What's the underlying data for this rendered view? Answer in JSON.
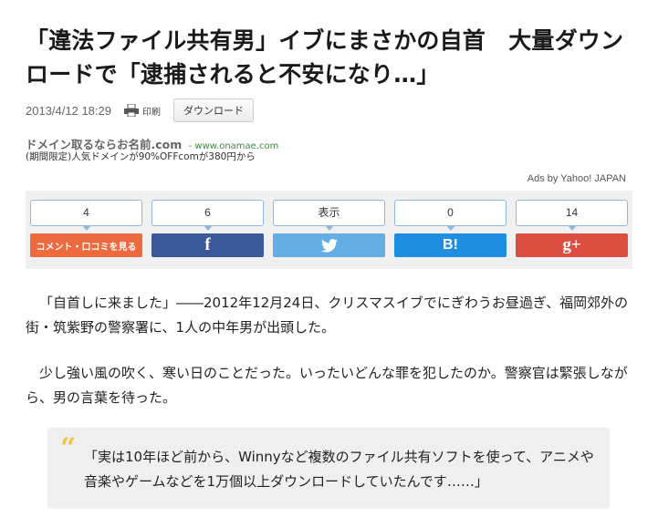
{
  "article": {
    "headline": "「違法ファイル共有男」イブにまさかの自首　大量ダウンロードで「逮捕されると不安になり…」",
    "date": "2013/4/12 18:29",
    "print_label": "印刷",
    "download_button": "ダウンロード"
  },
  "ad": {
    "title": "ドメイン取るならお名前.com",
    "url": "- www.onamae.com",
    "description": "(期間限定)人気ドメインが90%OFFcomが380円から",
    "credit": "Ads by Yahoo! JAPAN"
  },
  "share": {
    "comment": {
      "count": "4",
      "label": "コメント・口コミを見る",
      "color": "#ec6a3e"
    },
    "facebook": {
      "count": "6",
      "label": "f",
      "color": "#3b5998"
    },
    "twitter": {
      "count": "表示",
      "color": "#63aee5",
      "icon": "twitter-bird-icon"
    },
    "hatena": {
      "count": "0",
      "label": "B!",
      "color": "#1d8ee0"
    },
    "googleplus": {
      "count": "14",
      "label": "g+",
      "color": "#dc4e3f"
    }
  },
  "body": {
    "paragraph_1": "「自首しに来ました」――2012年12月24日、クリスマスイブでにぎわうお昼過ぎ、福岡郊外の街・筑紫野の警察署に、1人の中年男が出頭した。",
    "paragraph_2": "少し強い風の吹く、寒い日のことだった。いったいどんな罪を犯したのか。警察官は緊張しながら、男の言葉を待った。",
    "quote": "「実は10年ほど前から、Winnyなど複数のファイル共有ソフトを使って、アニメや音楽やゲームなどを1万個以上ダウンロードしていたんです……」",
    "quote_color": "#f0c53e"
  }
}
